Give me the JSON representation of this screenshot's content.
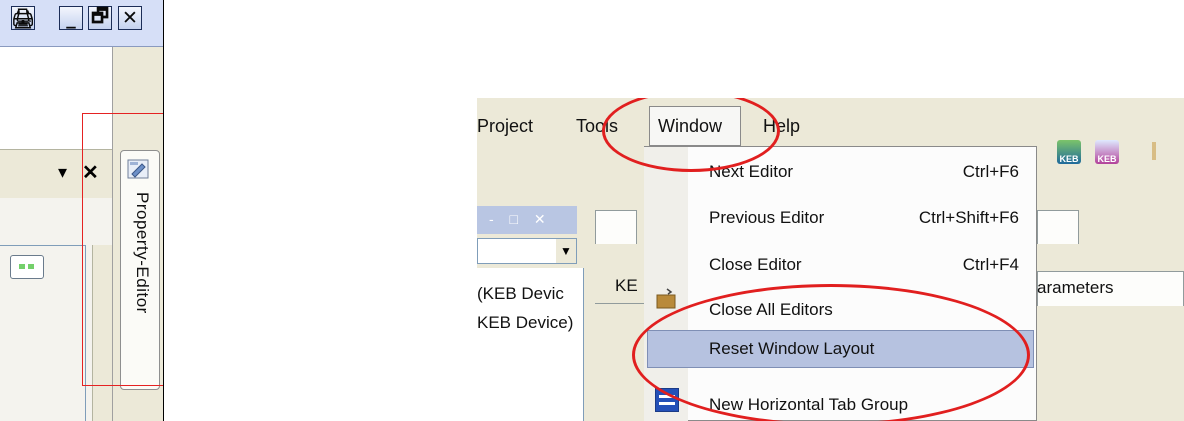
{
  "left_panel": {
    "window_buttons": [
      "🖨",
      "_",
      "🗗",
      "✕"
    ],
    "view_header": {
      "dropdown_glyph": "▾",
      "close_glyph": "✕"
    },
    "side_tab_label": "Property-Editor",
    "side_tab_icon": "property-editor-icon"
  },
  "right_panel": {
    "menubar": [
      "Project",
      "Tools",
      "Window",
      "Help"
    ],
    "panel_titlebar_glyphs": "- □ ✕",
    "device_dropdown_glyph": "▼",
    "device_items": [
      "(KEB Devic",
      "KEB Device)"
    ],
    "inner_tab_label": "KE",
    "param_tab_label": "arameters",
    "toolbar_icon_labels": [
      "KEB",
      "KEB"
    ],
    "window_menu": {
      "items": [
        {
          "label": "Next Editor",
          "shortcut": "Ctrl+F6"
        },
        {
          "label": "Previous Editor",
          "shortcut": "Ctrl+Shift+F6"
        },
        {
          "label": "Close Editor",
          "shortcut": "Ctrl+F4"
        },
        {
          "label": "Close All Editors",
          "shortcut": ""
        },
        {
          "label": "Reset Window Layout",
          "shortcut": ""
        },
        {
          "label": "New Horizontal Tab Group",
          "shortcut": ""
        }
      ],
      "highlighted": "Reset Window Layout"
    }
  },
  "annotation_colors": {
    "highlight_red": "#e52222",
    "menu_highlight": "#b6c2e0"
  }
}
